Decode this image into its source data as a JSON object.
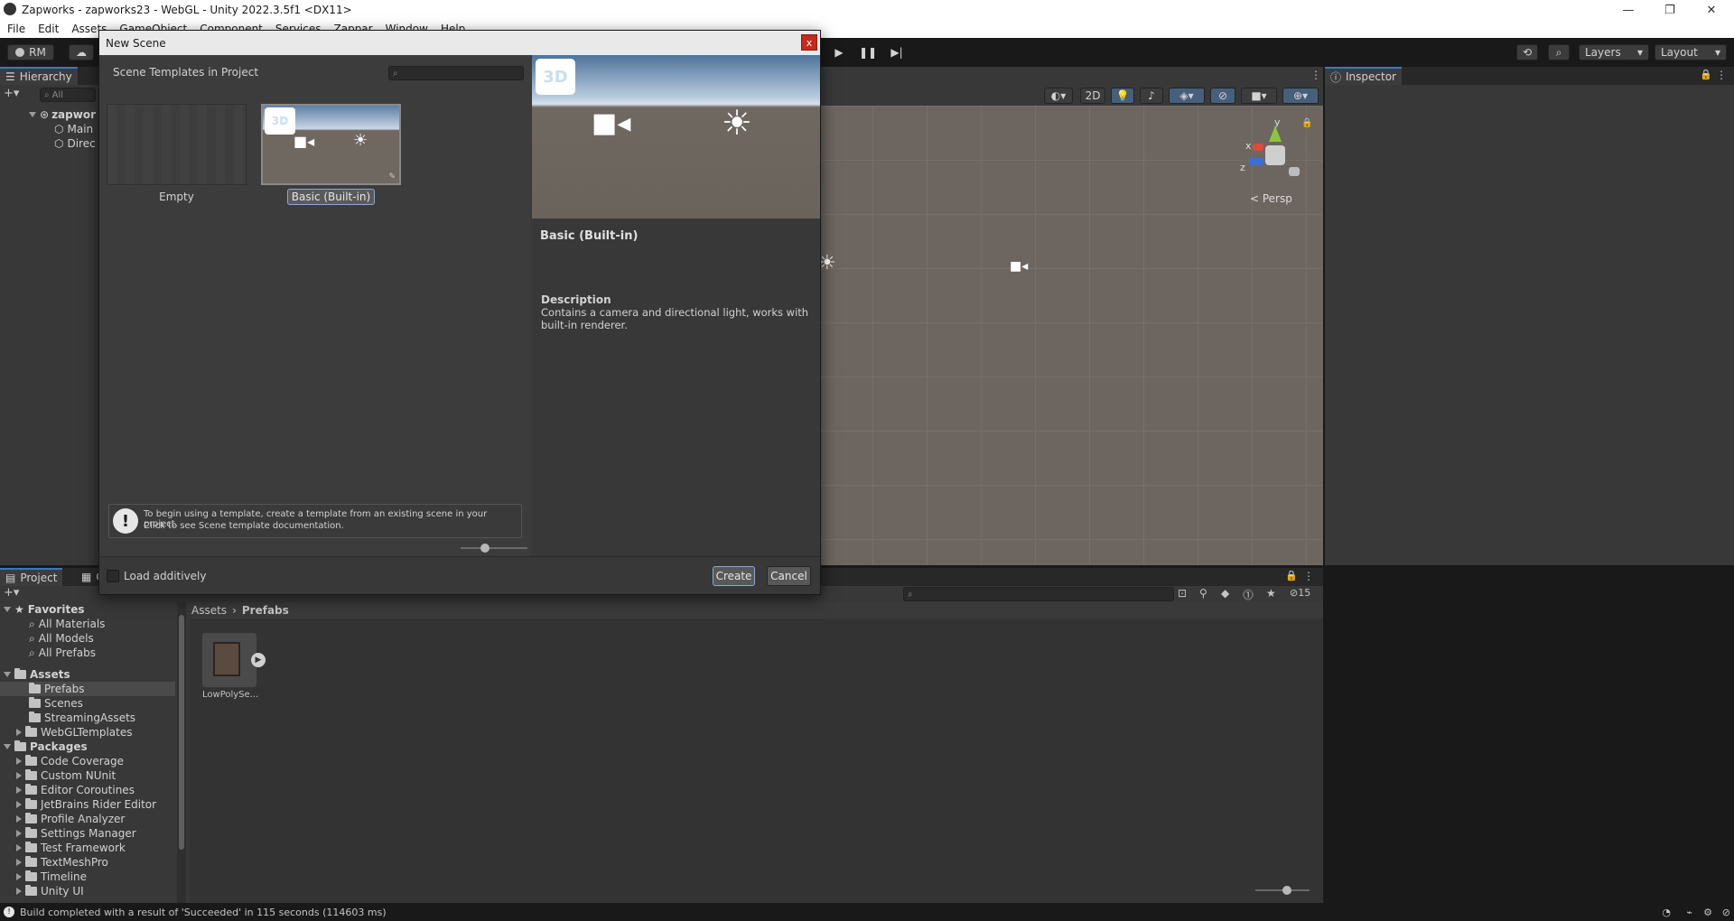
{
  "window": {
    "title": "Zapworks - zapworks23 - WebGL - Unity 2022.3.5f1 <DX11>",
    "minimize": "—",
    "restore": "❐",
    "close": "✕"
  },
  "menu": [
    "File",
    "Edit",
    "Assets",
    "GameObject",
    "Component",
    "Services",
    "Zappar",
    "Window",
    "Help"
  ],
  "toolbar": {
    "account": "RM",
    "layers": "Layers",
    "layout": "Layout"
  },
  "hierarchy": {
    "tab": "Hierarchy",
    "search_placeholder": "All",
    "root": "zapwor",
    "items": [
      "Main",
      "Direc"
    ]
  },
  "scene": {
    "mode_2d": "2D",
    "persp": "< Persp",
    "axis_y": "y",
    "axis_x": "x",
    "axis_z": "z"
  },
  "inspector": {
    "tab": "Inspector"
  },
  "project": {
    "tab": "Project",
    "tab2": "C",
    "hidden_count": "15",
    "breadcrumb": [
      "Assets",
      "Prefabs"
    ],
    "favorites": {
      "label": "Favorites",
      "items": [
        "All Materials",
        "All Models",
        "All Prefabs"
      ]
    },
    "assets": {
      "label": "Assets",
      "items": [
        "Prefabs",
        "Scenes",
        "StreamingAssets",
        "WebGLTemplates"
      ]
    },
    "packages": {
      "label": "Packages",
      "items": [
        "Code Coverage",
        "Custom NUnit",
        "Editor Coroutines",
        "JetBrains Rider Editor",
        "Profile Analyzer",
        "Settings Manager",
        "Test Framework",
        "TextMeshPro",
        "Timeline",
        "Unity UI"
      ]
    },
    "asset_name": "LowPolySe..."
  },
  "dialog": {
    "title": "New Scene",
    "close": "x",
    "templates_header": "Scene Templates in Project",
    "templates": [
      {
        "name": "Empty"
      },
      {
        "name": "Basic (Built-in)"
      }
    ],
    "preview_badge": "3D",
    "selected_name": "Basic (Built-in)",
    "description_label": "Description",
    "description": "Contains a camera and directional light, works with built-in renderer.",
    "info_line1": "To begin using a template, create a template from an existing scene in your project.",
    "info_line2": "Click to see Scene template documentation.",
    "load_additively": "Load additively",
    "create": "Create",
    "cancel": "Cancel"
  },
  "status": {
    "text": "Build completed with a result of 'Succeeded' in 115 seconds (114603 ms)"
  },
  "colors": {
    "accent": "#3a79bb",
    "panel": "#383838",
    "scene_ground": "#6d6560"
  }
}
